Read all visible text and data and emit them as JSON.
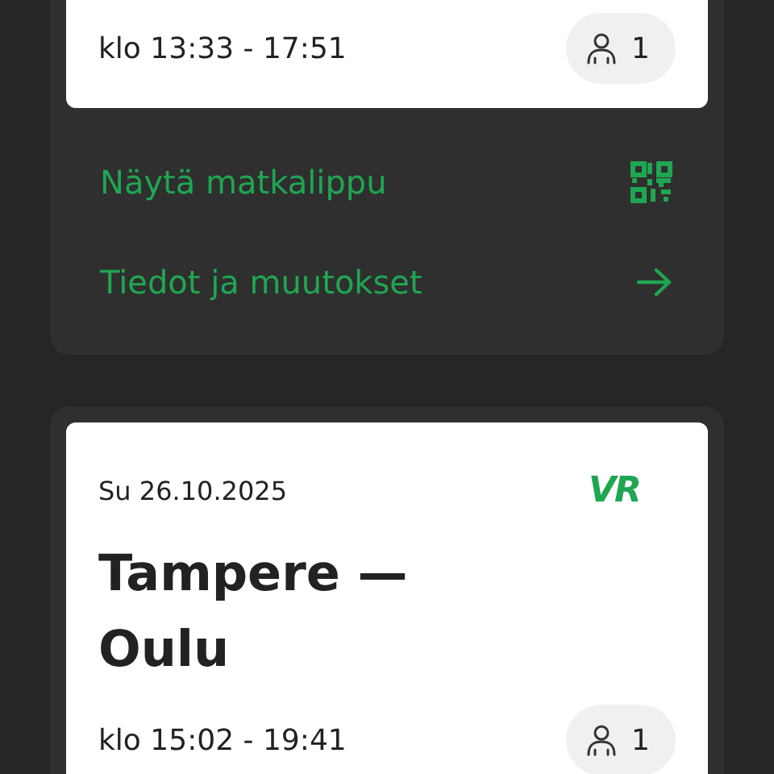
{
  "trips": [
    {
      "time": "klo 13:33 - 17:51",
      "passengers": "1",
      "actions": [
        {
          "label": "Näytä matkalippu",
          "kind": "qr"
        },
        {
          "label": "Tiedot ja muutokset",
          "kind": "arrow"
        }
      ]
    },
    {
      "date": "Su 26.10.2025",
      "logo": "VR",
      "title": "Tampere —\nOulu",
      "time": "klo 15:02 - 19:41",
      "passengers": "1"
    }
  ]
}
